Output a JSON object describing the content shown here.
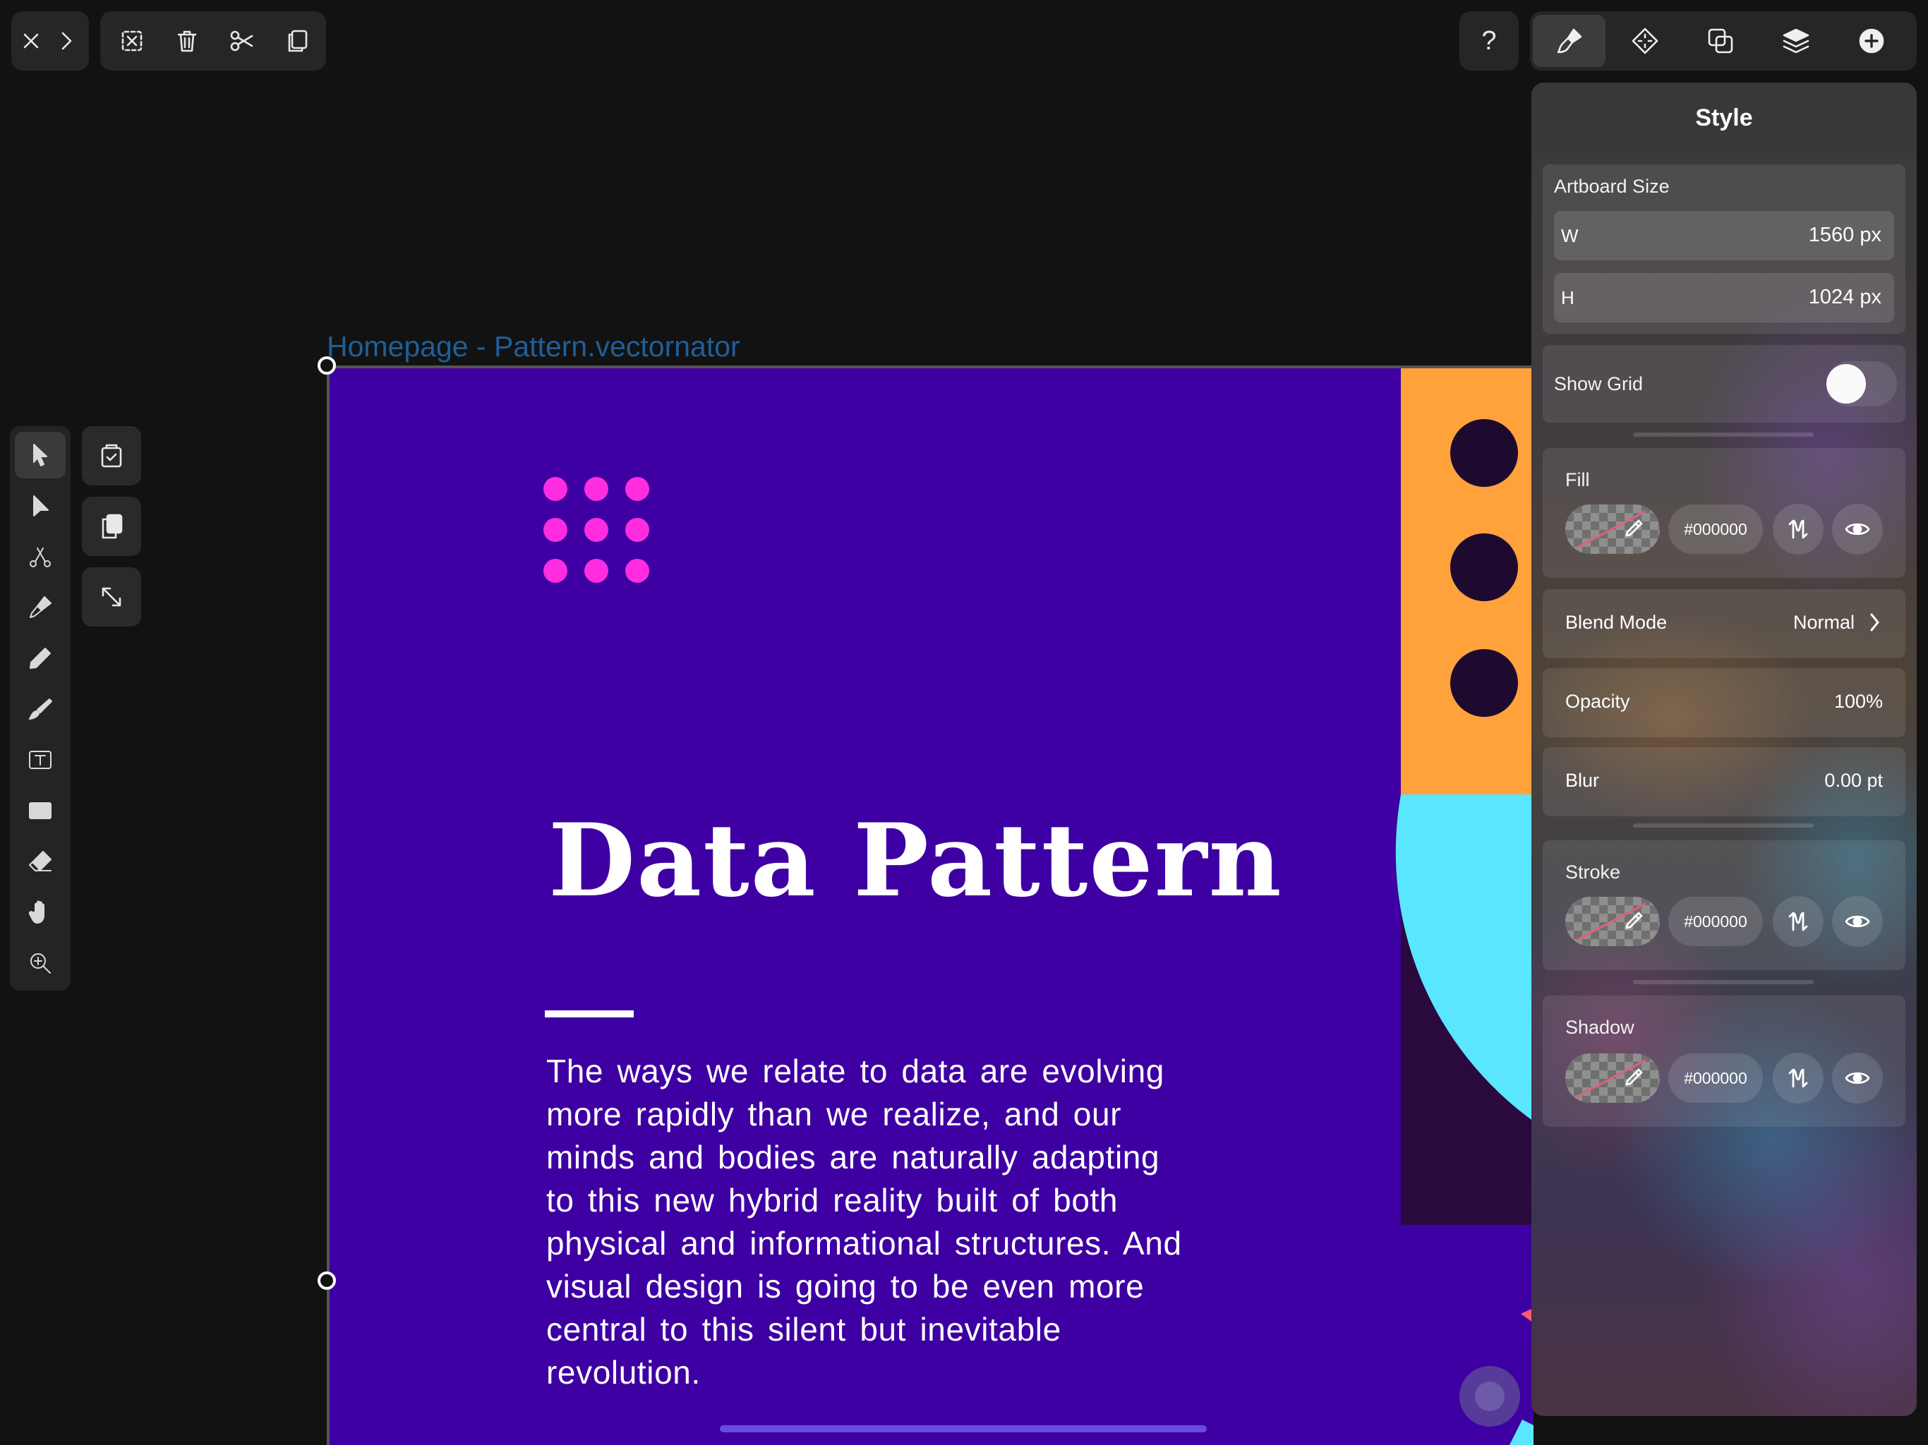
{
  "top_toolbar": {
    "nav": [
      {
        "icon": "close-icon"
      },
      {
        "icon": "chevron-right-icon"
      }
    ],
    "edit": [
      {
        "icon": "deselect-icon"
      },
      {
        "icon": "trash-icon"
      },
      {
        "icon": "scissors-icon"
      },
      {
        "icon": "duplicate-icon"
      }
    ]
  },
  "help": {
    "label": "?"
  },
  "right_tabs": [
    {
      "icon": "style-brush-icon",
      "active": true
    },
    {
      "icon": "arrange-icon",
      "active": false
    },
    {
      "icon": "path-operations-icon",
      "active": false
    },
    {
      "icon": "layers-icon",
      "active": false
    },
    {
      "icon": "add-icon",
      "active": false
    }
  ],
  "tools": [
    {
      "icon": "select-arrow-icon",
      "active": true
    },
    {
      "icon": "direct-select-icon",
      "active": false
    },
    {
      "icon": "node-scissors-icon",
      "active": false
    },
    {
      "icon": "pen-icon",
      "active": false
    },
    {
      "icon": "pencil-icon",
      "active": false
    },
    {
      "icon": "brush-icon",
      "active": false
    },
    {
      "icon": "text-icon",
      "active": false
    },
    {
      "icon": "rectangle-icon",
      "active": false
    },
    {
      "icon": "eraser-icon",
      "active": false
    },
    {
      "icon": "hand-icon",
      "active": false
    },
    {
      "icon": "zoom-icon",
      "active": false
    }
  ],
  "quick_actions": [
    {
      "icon": "paste-icon"
    },
    {
      "icon": "copy-icon"
    },
    {
      "icon": "fit-expand-icon"
    }
  ],
  "canvas": {
    "artboard_title": "Homepage - Pattern.vectornator",
    "headline": "Data Pattern",
    "paragraph": "The ways we relate to data are evolving more rapidly than we realize, and our minds and bodies are naturally adapting to this new hybrid reality built of both physical and informational structures. And visual design is going to be even more central to this silent but inevitable revolution.",
    "colors": {
      "artboard": "#3e00a2",
      "dots": "#ff2ce0",
      "orange": "#ffa23c",
      "cyan": "#5ae6ff",
      "dark": "#1e0a2e"
    }
  },
  "panel": {
    "title": "Style",
    "artboard_size": {
      "label": "Artboard Size",
      "w_key": "W",
      "w_value": "1560 px",
      "h_key": "H",
      "h_value": "1024 px"
    },
    "show_grid": {
      "label": "Show Grid",
      "on": false
    },
    "fill": {
      "label": "Fill",
      "hex": "#000000"
    },
    "blend_mode": {
      "label": "Blend Mode",
      "value": "Normal"
    },
    "opacity": {
      "label": "Opacity",
      "value": "100%"
    },
    "blur": {
      "label": "Blur",
      "value": "0.00 pt"
    },
    "stroke": {
      "label": "Stroke",
      "hex": "#000000"
    },
    "shadow": {
      "label": "Shadow",
      "hex": "#000000"
    }
  }
}
